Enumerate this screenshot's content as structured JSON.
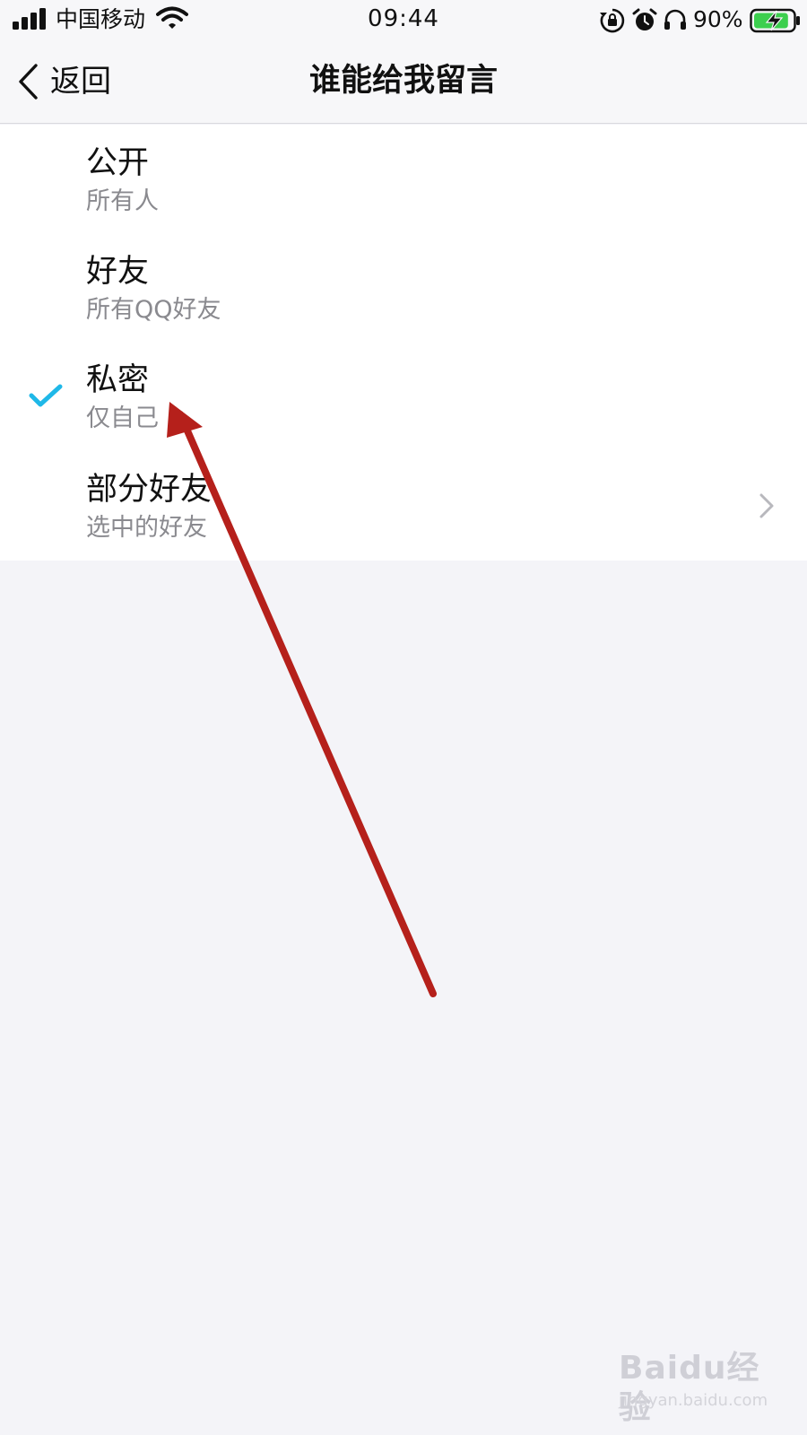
{
  "status_bar": {
    "carrier": "中国移动",
    "time": "09:44",
    "battery_percent": "90%",
    "battery_level": 0.9,
    "battery_color": "#3ccf4e",
    "icons": [
      "signal-icon",
      "wifi-icon",
      "rotation-lock-icon",
      "alarm-icon",
      "headphones-icon",
      "battery-charging-icon"
    ]
  },
  "nav": {
    "back_label": "返回",
    "title": "谁能给我留言"
  },
  "options": [
    {
      "title": "公开",
      "subtitle": "所有人",
      "selected": false
    },
    {
      "title": "好友",
      "subtitle": "所有QQ好友",
      "selected": false
    },
    {
      "title": "私密",
      "subtitle": "仅自己",
      "selected": true
    },
    {
      "title": "部分好友",
      "subtitle": "选中的好友",
      "selected": false,
      "has_chevron": true
    }
  ],
  "colors": {
    "check": "#1fb8e8",
    "annotation_arrow": "#b5201b",
    "background": "#f4f4f8"
  },
  "watermark": {
    "logo": "Baidu经验",
    "url": "jingyan.baidu.com"
  }
}
